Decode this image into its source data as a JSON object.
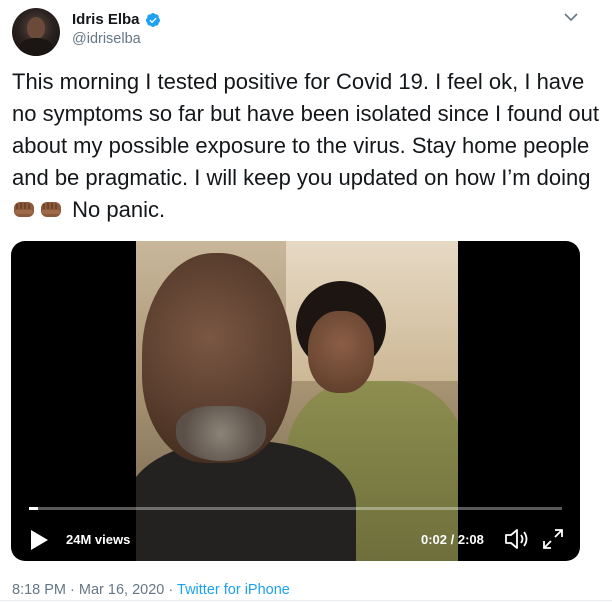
{
  "author": {
    "display_name": "Idris Elba",
    "handle": "@idriselba",
    "verified": true,
    "avatar_icon": "profile-avatar"
  },
  "tweet": {
    "text_before_emoji": "This morning I tested positive for Covid 19. I feel ok, I have no symptoms so far but have been isolated since I found out about my possible exposure to the virus. Stay home people and be pragmatic. I will keep you updated on how I’m doing",
    "emoji": [
      "fisted-hand-medium-dark-skin",
      "fisted-hand-medium-dark-skin"
    ],
    "text_after_emoji": "No panic."
  },
  "video": {
    "views": "24M views",
    "time": "0:02 / 2:08",
    "progress": 0.016,
    "icons": [
      "play-icon",
      "volume-icon",
      "fullscreen-icon"
    ]
  },
  "meta": {
    "time": "8:18 PM",
    "separator": "·",
    "date": "Mar 16, 2020",
    "source": "Twitter for iPhone"
  },
  "colors": {
    "text": "#14171a",
    "secondary": "#657786",
    "link": "#1da1f2",
    "verified": "#1da1f2",
    "divider": "#e6ecf0"
  }
}
